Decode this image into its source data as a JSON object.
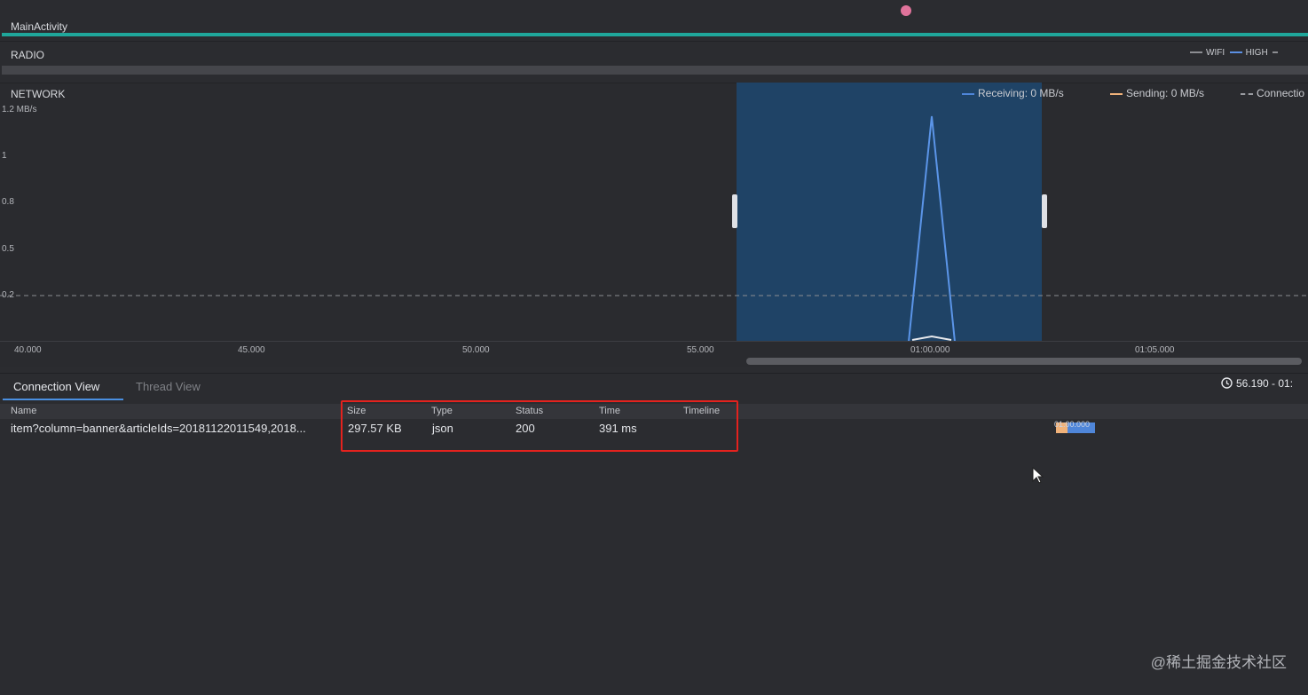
{
  "activity": {
    "label": "MainActivity"
  },
  "radio": {
    "label": "RADIO",
    "legend": [
      {
        "name": "WIFI",
        "color": "#8c8d92"
      },
      {
        "name": "HIGH",
        "color": "#5b8fe3"
      }
    ]
  },
  "network": {
    "label": "NETWORK",
    "legend": {
      "receiving": "Receiving: 0 MB/s",
      "sending": "Sending: 0 MB/s",
      "connections": "Connectio"
    },
    "colors": {
      "receiving": "#4f86d9",
      "sending": "#f0b27a",
      "selection": "#1f4366"
    },
    "y_ticks": [
      "1.2 MB/s",
      "1",
      "0.8",
      "0.5",
      "0.2"
    ],
    "x_ticks": [
      "40.000",
      "45.000",
      "50.000",
      "55.000",
      "01:00.000",
      "01:05.000"
    ]
  },
  "tabs": [
    {
      "label": "Connection View",
      "active": true
    },
    {
      "label": "Thread View",
      "active": false
    }
  ],
  "time_range": "56.190 - 01:",
  "table": {
    "headers": {
      "name": "Name",
      "size": "Size",
      "type": "Type",
      "status": "Status",
      "time": "Time",
      "timeline": "Timeline"
    },
    "rows": [
      {
        "name": "item?column=banner&articleIds=20181122011549,2018...",
        "size": "297.57 KB",
        "type": "json",
        "status": "200",
        "time": "391 ms",
        "timeline_label": "01:00.000"
      }
    ]
  },
  "watermark": "@稀土掘金技术社区"
}
